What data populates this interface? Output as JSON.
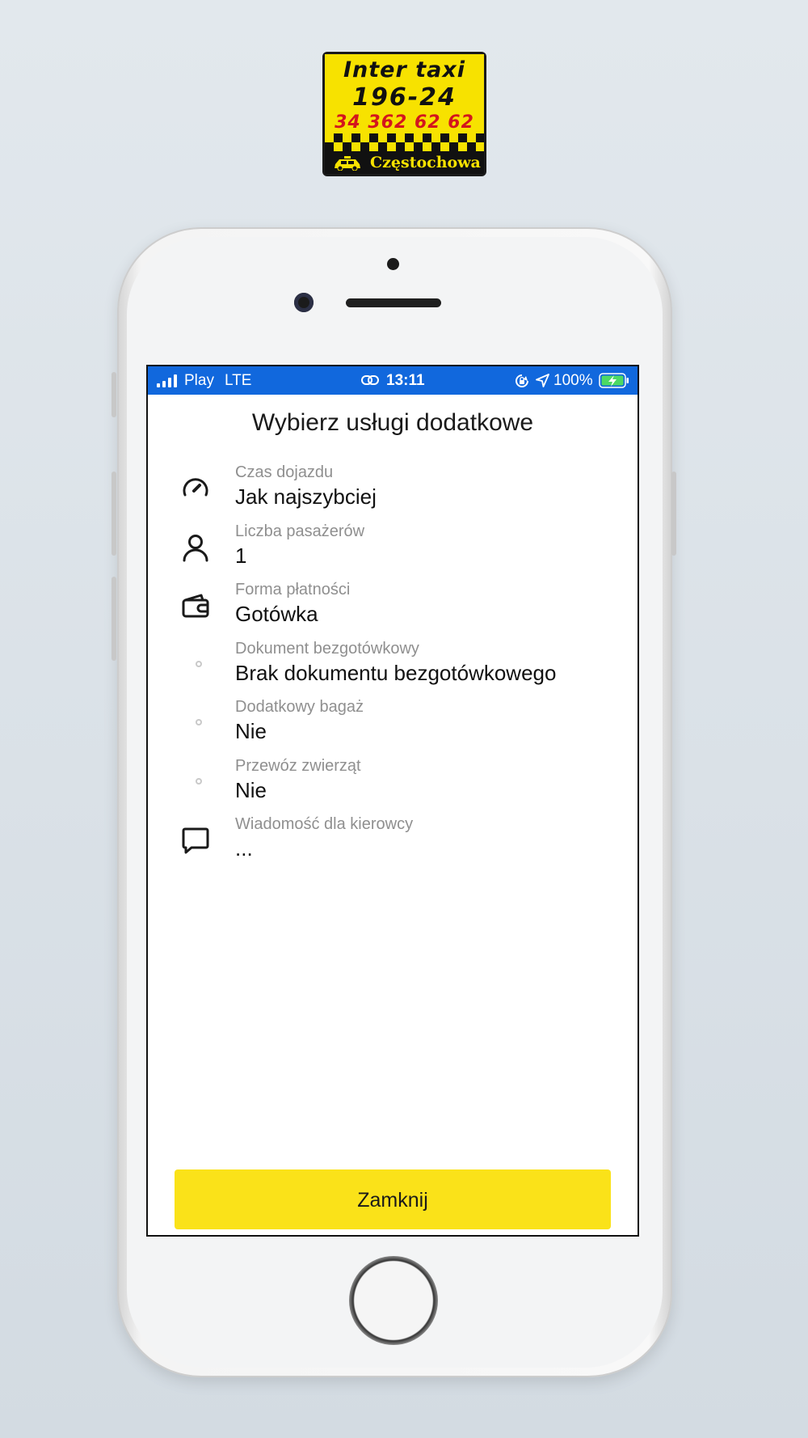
{
  "logo": {
    "line1": "Inter taxi",
    "line2": "196-24",
    "line3": "34 362 62 62",
    "city": "Częstochowa"
  },
  "statusbar": {
    "carrier": "Play",
    "network": "LTE",
    "time": "13:11",
    "battery": "100%",
    "icons": [
      "signal-icon",
      "link-icon",
      "rotation-lock-icon",
      "location-arrow-icon",
      "battery-charging-icon"
    ]
  },
  "screen": {
    "title": "Wybierz usługi dodatkowe",
    "items": [
      {
        "icon": "speedometer-icon",
        "label": "Czas dojazdu",
        "value": "Jak najszybciej"
      },
      {
        "icon": "person-icon",
        "label": "Liczba pasażerów",
        "value": "1"
      },
      {
        "icon": "wallet-icon",
        "label": "Forma płatności",
        "value": "Gotówka"
      },
      {
        "icon": "dot-icon",
        "label": "Dokument bezgotówkowy",
        "value": "Brak dokumentu bezgotówkowego"
      },
      {
        "icon": "dot-icon",
        "label": "Dodatkowy bagaż",
        "value": "Nie"
      },
      {
        "icon": "dot-icon",
        "label": "Przewóz zwierząt",
        "value": "Nie"
      },
      {
        "icon": "chat-bubble-icon",
        "label": "Wiadomość dla kierowcy",
        "value": "..."
      }
    ],
    "close_label": "Zamknij"
  },
  "colors": {
    "statusbar": "#1168dd",
    "button": "#fae219",
    "label": "#8f8f8f",
    "value": "#111111"
  }
}
